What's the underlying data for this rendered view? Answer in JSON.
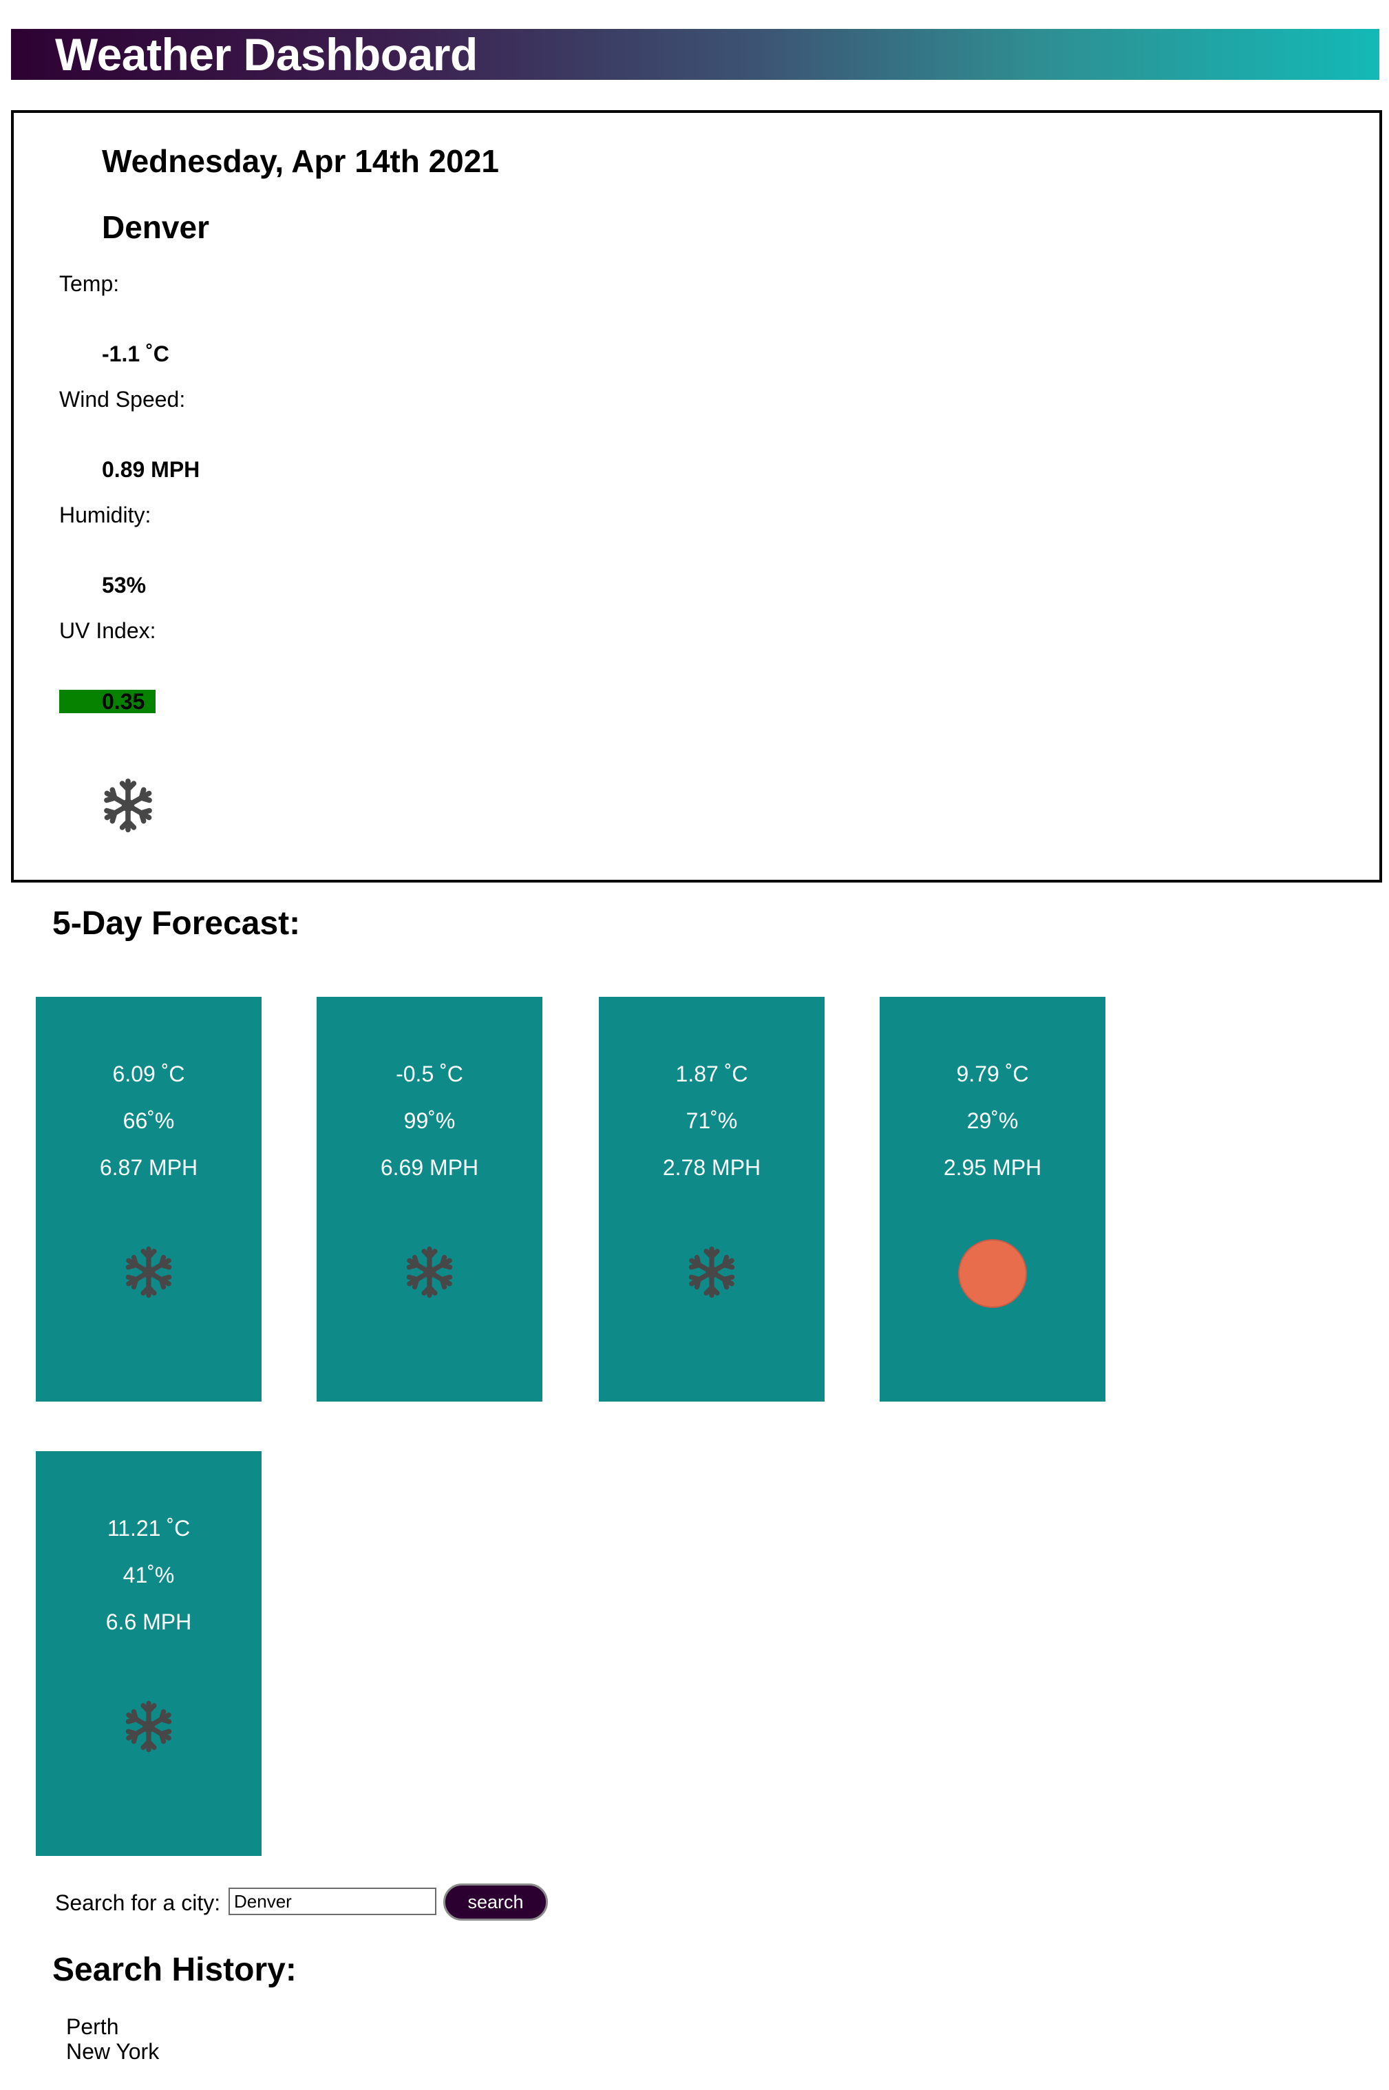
{
  "header": {
    "title": "Weather Dashboard"
  },
  "current": {
    "date": "Wednesday, Apr 14th 2021",
    "city": "Denver",
    "temp_label": "Temp:",
    "temp_value": "-1.1 ˚C",
    "wind_label": "Wind Speed:",
    "wind_value": "0.89 MPH",
    "humidity_label": "Humidity:",
    "humidity_value": "53%",
    "uv_label": "UV Index:",
    "uv_value": "0.35",
    "uv_color": "#078100",
    "icon": "snowflake-icon"
  },
  "forecast": {
    "heading": "5-Day Forecast:",
    "cards": [
      {
        "temp": "6.09 ˚C",
        "humidity": "66˚%",
        "wind": "6.87 MPH",
        "icon": "snowflake-icon"
      },
      {
        "temp": "-0.5 ˚C",
        "humidity": "99˚%",
        "wind": "6.69 MPH",
        "icon": "snowflake-icon"
      },
      {
        "temp": "1.87 ˚C",
        "humidity": "71˚%",
        "wind": "2.78 MPH",
        "icon": "snowflake-icon"
      },
      {
        "temp": "9.79 ˚C",
        "humidity": "29˚%",
        "wind": "2.95 MPH",
        "icon": "sun-icon"
      },
      {
        "temp": "11.21 ˚C",
        "humidity": "41˚%",
        "wind": "6.6 MPH",
        "icon": "snowflake-icon"
      }
    ],
    "card_color": "#0e8a89"
  },
  "search": {
    "label": "Search for a city:",
    "value": "Denver",
    "button_label": "search"
  },
  "history": {
    "heading": "Search History:",
    "items": [
      "Perth",
      "New York"
    ]
  }
}
